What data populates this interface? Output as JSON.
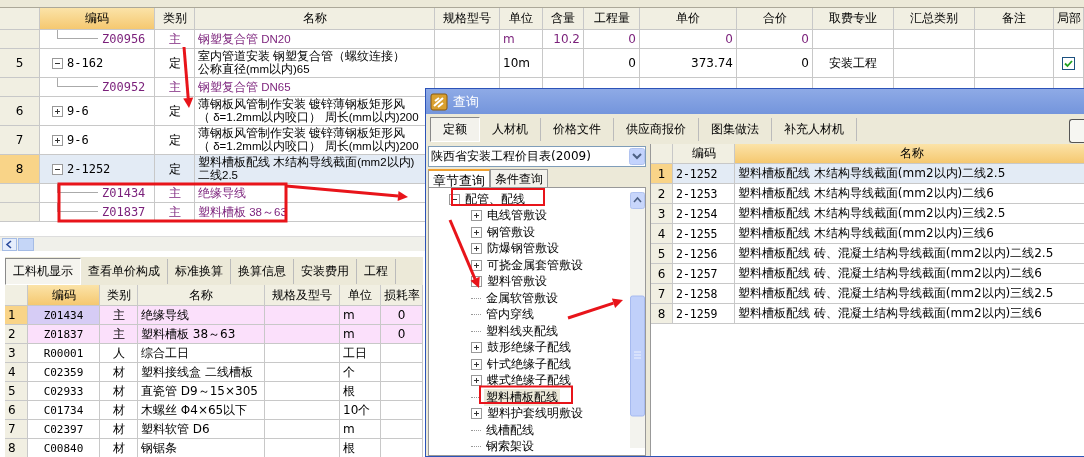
{
  "main_table": {
    "columns": [
      {
        "label": "编码",
        "selected": true
      },
      {
        "label": "类别",
        "selected": false
      },
      {
        "label": "名称",
        "selected": false
      },
      {
        "label": "规格型号",
        "selected": false
      },
      {
        "label": "单位",
        "selected": false
      },
      {
        "label": "含量",
        "selected": false
      },
      {
        "label": "工程量",
        "selected": false
      },
      {
        "label": "单价",
        "selected": false
      },
      {
        "label": "合价",
        "selected": false
      },
      {
        "label": "取费专业",
        "selected": false
      },
      {
        "label": "汇总类别",
        "selected": false
      },
      {
        "label": "备注",
        "selected": false
      },
      {
        "label": "局部",
        "selected": false
      }
    ],
    "rows": [
      {
        "kind": "material",
        "code": "Z00956",
        "type": "主",
        "name": [
          "钢塑复合管 DN20"
        ],
        "unit": "m",
        "content": "10.2",
        "qty": "0",
        "price": "0",
        "total": "0",
        "selected": false
      },
      {
        "kind": "quota",
        "num": "5",
        "code": "8-162",
        "expanded": true,
        "type": "定",
        "name": [
          "室内管道安装 钢塑复合管（螺纹连接）",
          "公称直径(mm以内)65"
        ],
        "unit": "10m",
        "qty": "0",
        "price": "373.74",
        "total": "0",
        "fee": "安装工程",
        "local": true,
        "selected": false
      },
      {
        "kind": "material",
        "code": "Z00952",
        "type": "主",
        "name": [
          "钢塑复合管 DN65"
        ],
        "selected": false
      },
      {
        "kind": "quota",
        "num": "6",
        "code": "9-6",
        "expanded": false,
        "type": "定",
        "name": [
          "薄钢板风管制作安装 镀锌薄钢板矩形风",
          "（ δ=1.2mm以内咬口） 周长(mm以内)200"
        ],
        "selected": false
      },
      {
        "kind": "quota",
        "num": "7",
        "code": "9-6",
        "expanded": false,
        "type": "定",
        "name": [
          "薄钢板风管制作安装 镀锌薄钢板矩形风",
          "（ δ=1.2mm以内咬口） 周长(mm以内)200"
        ],
        "selected": false
      },
      {
        "kind": "quota",
        "num": "8",
        "code": "2-1252",
        "expanded": true,
        "type": "定",
        "name": [
          "塑料槽板配线 木结构导线截面(mm2以内)",
          "二线2.5"
        ],
        "selected": true
      },
      {
        "kind": "material",
        "code": "Z01434",
        "type": "主",
        "name": [
          "绝缘导线"
        ],
        "selected": false
      },
      {
        "kind": "material",
        "code": "Z01837",
        "type": "主",
        "name": [
          "塑料槽板 38～63"
        ],
        "selected": false
      }
    ]
  },
  "bottom_tabs": [
    {
      "label": "工料机显示",
      "selected": true
    },
    {
      "label": "查看单价构成",
      "selected": false
    },
    {
      "label": "标准换算",
      "selected": false
    },
    {
      "label": "换算信息",
      "selected": false
    },
    {
      "label": "安装费用",
      "selected": false
    },
    {
      "label": "工程",
      "selected": false
    }
  ],
  "resource_table": {
    "columns": [
      {
        "label": "编码",
        "selected": true
      },
      {
        "label": "类别",
        "selected": false
      },
      {
        "label": "名称",
        "selected": false
      },
      {
        "label": "规格及型号",
        "selected": false
      },
      {
        "label": "单位",
        "selected": false
      },
      {
        "label": "损耗率",
        "selected": false
      }
    ],
    "rows": [
      {
        "num": "1",
        "kind": "main",
        "code": "Z01434",
        "type": "主",
        "name": "绝缘导线",
        "unit": "m",
        "loss": "0",
        "selected": true
      },
      {
        "num": "2",
        "kind": "main",
        "code": "Z01837",
        "type": "主",
        "name": "塑料槽板 38～63",
        "unit": "m",
        "loss": "0",
        "selected": false
      },
      {
        "num": "3",
        "kind": "normal",
        "code": "R00001",
        "type": "人",
        "name": "综合工日",
        "unit": "工日",
        "selected": false
      },
      {
        "num": "4",
        "kind": "normal",
        "code": "C02359",
        "type": "材",
        "name": "塑料接线盒 二线槽板",
        "unit": "个",
        "selected": false
      },
      {
        "num": "5",
        "kind": "normal",
        "code": "C02933",
        "type": "材",
        "name": "直瓷管 D9～15×305",
        "unit": "根",
        "selected": false
      },
      {
        "num": "6",
        "kind": "normal",
        "code": "C01734",
        "type": "材",
        "name": "木螺丝 Φ4×65以下",
        "unit": "10个",
        "selected": false
      },
      {
        "num": "7",
        "kind": "normal",
        "code": "C02397",
        "type": "材",
        "name": "塑料软管 D6",
        "unit": "m",
        "selected": false
      },
      {
        "num": "8",
        "kind": "normal",
        "code": "C00840",
        "type": "材",
        "name": "钢锯条",
        "unit": "根",
        "selected": false
      }
    ]
  },
  "dialog": {
    "title": "查询",
    "tabs": [
      {
        "label": "定额",
        "selected": true
      },
      {
        "label": "人材机",
        "selected": false
      },
      {
        "label": "价格文件",
        "selected": false
      },
      {
        "label": "供应商报价",
        "selected": false
      },
      {
        "label": "图集做法",
        "selected": false
      },
      {
        "label": "补充人材机",
        "selected": false
      }
    ],
    "library": "陕西省安装工程价目表(2009)",
    "subtabs": [
      {
        "label": "章节查询",
        "selected": true
      },
      {
        "label": "条件查询",
        "selected": false
      }
    ],
    "tree": [
      {
        "label": "配管、配线",
        "expanded": true,
        "selected": false,
        "children": [
          {
            "label": "电线管敷设",
            "expanded": false,
            "selected": false
          },
          {
            "label": "钢管敷设",
            "expanded": false,
            "selected": false
          },
          {
            "label": "防爆钢管敷设",
            "expanded": false,
            "selected": false
          },
          {
            "label": "可挠金属套管敷设",
            "expanded": false,
            "selected": false
          },
          {
            "label": "塑料管敷设",
            "expanded": false,
            "selected": false
          },
          {
            "label": "金属软管敷设",
            "selected": false
          },
          {
            "label": "管内穿线",
            "selected": false
          },
          {
            "label": "塑料线夹配线",
            "selected": false
          },
          {
            "label": "鼓形绝缘子配线",
            "expanded": false,
            "selected": false
          },
          {
            "label": "针式绝缘子配线",
            "expanded": false,
            "selected": false
          },
          {
            "label": "蝶式绝缘子配线",
            "expanded": false,
            "selected": false
          },
          {
            "label": "塑料槽板配线",
            "selected": true
          },
          {
            "label": "塑料护套线明敷设",
            "expanded": false,
            "selected": false
          },
          {
            "label": "线槽配线",
            "selected": false
          },
          {
            "label": "钢索架设",
            "selected": false
          }
        ]
      }
    ],
    "results": {
      "columns": [
        {
          "label": "编码",
          "selected": false
        },
        {
          "label": "名称",
          "selected": true
        }
      ],
      "rows": [
        {
          "num": "1",
          "code": "2-1252",
          "name": "塑料槽板配线 木结构导线截面(mm2以内)二线2.5",
          "selected": true
        },
        {
          "num": "2",
          "code": "2-1253",
          "name": "塑料槽板配线 木结构导线截面(mm2以内)二线6",
          "selected": false
        },
        {
          "num": "3",
          "code": "2-1254",
          "name": "塑料槽板配线 木结构导线截面(mm2以内)三线2.5",
          "selected": false
        },
        {
          "num": "4",
          "code": "2-1255",
          "name": "塑料槽板配线 木结构导线截面(mm2以内)三线6",
          "selected": false
        },
        {
          "num": "5",
          "code": "2-1256",
          "name": "塑料槽板配线 砖、混凝土结构导线截面(mm2以内)二线2.5",
          "selected": false
        },
        {
          "num": "6",
          "code": "2-1257",
          "name": "塑料槽板配线 砖、混凝土结构导线截面(mm2以内)二线6",
          "selected": false
        },
        {
          "num": "7",
          "code": "2-1258",
          "name": "塑料槽板配线 砖、混凝土结构导线截面(mm2以内)三线2.5",
          "selected": false
        },
        {
          "num": "8",
          "code": "2-1259",
          "name": "塑料槽板配线 砖、混凝土结构导线截面(mm2以内)三线6",
          "selected": false
        }
      ]
    }
  }
}
